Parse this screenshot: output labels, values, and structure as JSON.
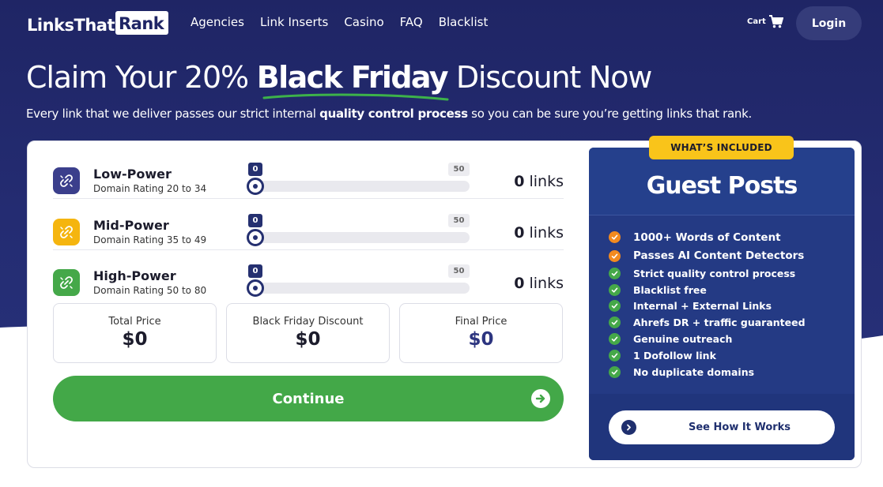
{
  "nav": {
    "logo_part1": "LinksThat",
    "logo_part2": "Rank",
    "links": [
      "Agencies",
      "Link Inserts",
      "Casino",
      "FAQ",
      "Blacklist"
    ],
    "cart_label": "Cart",
    "login_label": "Login"
  },
  "hero": {
    "headline_pre": "Claim Your 20% ",
    "headline_bold": "Black Friday",
    "headline_post": " Discount Now",
    "sub_pre": "Every link that we deliver passes our strict internal ",
    "sub_bold": "quality control process",
    "sub_post": " so you can be sure you’re getting links that rank."
  },
  "tiers": [
    {
      "title": "Low-Power",
      "subtitle": "Domain Rating 20 to 34",
      "min": "0",
      "max": "50",
      "value": 0,
      "count": "0",
      "count_unit": "links",
      "color": "#3b3f8c"
    },
    {
      "title": "Mid-Power",
      "subtitle": "Domain Rating 35 to 49",
      "min": "0",
      "max": "50",
      "value": 0,
      "count": "0",
      "count_unit": "links",
      "color": "#f5b50f"
    },
    {
      "title": "High-Power",
      "subtitle": "Domain Rating 50 to 80",
      "min": "0",
      "max": "50",
      "value": 0,
      "count": "0",
      "count_unit": "links",
      "color": "#45a849"
    }
  ],
  "prices": {
    "total_label": "Total Price",
    "total_value": "$0",
    "discount_label": "Black Friday Discount",
    "discount_value": "$0",
    "final_label": "Final Price",
    "final_value": "$0"
  },
  "continue_label": "Continue",
  "panel": {
    "badge": "WHAT’S INCLUDED",
    "title": "Guest Posts",
    "features": [
      {
        "text": "1000+ Words of Content",
        "color": "#f28a1f"
      },
      {
        "text": "Passes AI Content Detectors",
        "color": "#f28a1f"
      },
      {
        "text": "Strict quality control process",
        "color": "#45a849"
      },
      {
        "text": "Blacklist free",
        "color": "#45a849"
      },
      {
        "text": "Internal + External Links",
        "color": "#45a849"
      },
      {
        "text": "Ahrefs DR + traffic guaranteed",
        "color": "#45a849"
      },
      {
        "text": "Genuine outreach",
        "color": "#45a849"
      },
      {
        "text": "1 Dofollow link",
        "color": "#45a849"
      },
      {
        "text": "No duplicate domains",
        "color": "#45a849"
      }
    ],
    "how_label": "See How It Works"
  },
  "colors": {
    "navy": "#1f2565",
    "green": "#43a848",
    "yellow": "#f9c41a",
    "panel": "#243a84"
  }
}
